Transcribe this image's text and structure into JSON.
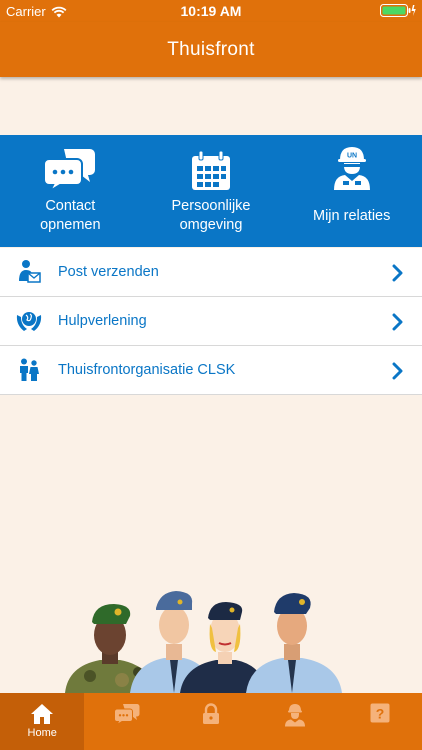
{
  "status_bar": {
    "carrier": "Carrier",
    "time": "10:19 AM"
  },
  "header": {
    "title": "Thuisfront"
  },
  "quick_actions": [
    {
      "label": "Contact\nopnemen",
      "icon": "chat-bubbles-icon"
    },
    {
      "label": "Persoonlijke\nomgeving",
      "icon": "calendar-icon"
    },
    {
      "label": "Mijn relaties",
      "icon": "un-soldier-icon",
      "badge": "UN"
    }
  ],
  "menu": [
    {
      "label": "Post verzenden",
      "icon": "mail-person-icon"
    },
    {
      "label": "Hulpverlening",
      "icon": "globe-hands-icon"
    },
    {
      "label": "Thuisfrontorganisatie CLSK",
      "icon": "people-icon"
    }
  ],
  "tabs": [
    {
      "label": "Home",
      "icon": "home-icon",
      "active": true
    },
    {
      "label": "",
      "icon": "chat-icon",
      "active": false
    },
    {
      "label": "",
      "icon": "lock-icon",
      "active": false
    },
    {
      "label": "",
      "icon": "soldier-icon",
      "active": false
    },
    {
      "label": "",
      "icon": "help-icon",
      "active": false
    }
  ],
  "colors": {
    "orange": "#e0710b",
    "blue": "#0a76c6",
    "background": "#fbf1e7"
  }
}
